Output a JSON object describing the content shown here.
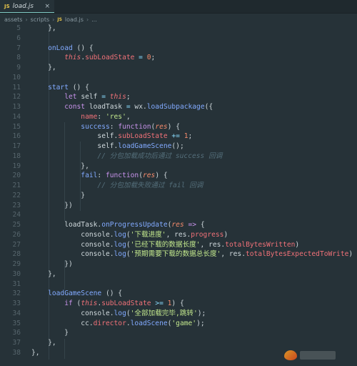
{
  "tab": {
    "badge": "JS",
    "label": "load.js",
    "close": "×"
  },
  "breadcrumb": [
    "assets",
    "scripts",
    "load.js",
    "..."
  ],
  "breadcrumb_badge": "JS",
  "colors": {
    "background": "#263238",
    "keyword": "#c792ea",
    "function": "#82aaff",
    "string": "#c3e88d",
    "number": "#f78c6c",
    "comment": "#546e7a"
  },
  "lines": [
    {
      "n": "5",
      "t": [
        {
          "c": "p",
          "v": "    },"
        }
      ]
    },
    {
      "n": "6",
      "t": []
    },
    {
      "n": "7",
      "t": [
        {
          "c": "fn",
          "v": "    onLoad"
        },
        {
          "c": "p",
          "v": " () {"
        }
      ]
    },
    {
      "n": "8",
      "t": [
        {
          "c": "th",
          "v": "        this"
        },
        {
          "c": "p",
          "v": "."
        },
        {
          "c": "var",
          "v": "subLoadState"
        },
        {
          "c": "op",
          "v": " = "
        },
        {
          "c": "num",
          "v": "0"
        },
        {
          "c": "p",
          "v": ";"
        }
      ]
    },
    {
      "n": "9",
      "t": [
        {
          "c": "p",
          "v": "    },"
        }
      ]
    },
    {
      "n": "10",
      "t": []
    },
    {
      "n": "11",
      "t": [
        {
          "c": "fn",
          "v": "    start"
        },
        {
          "c": "p",
          "v": " () {"
        }
      ]
    },
    {
      "n": "12",
      "t": [
        {
          "c": "kw",
          "v": "        let"
        },
        {
          "c": "p",
          "v": " self "
        },
        {
          "c": "op",
          "v": "="
        },
        {
          "c": "th",
          "v": " this"
        },
        {
          "c": "p",
          "v": ";"
        }
      ]
    },
    {
      "n": "13",
      "t": [
        {
          "c": "kw",
          "v": "        const"
        },
        {
          "c": "p",
          "v": " loadTask "
        },
        {
          "c": "op",
          "v": "="
        },
        {
          "c": "p",
          "v": " wx."
        },
        {
          "c": "fn",
          "v": "loadSubpackage"
        },
        {
          "c": "p",
          "v": "({"
        }
      ]
    },
    {
      "n": "14",
      "t": [
        {
          "c": "var",
          "v": "            name"
        },
        {
          "c": "p",
          "v": ": "
        },
        {
          "c": "str",
          "v": "'res'"
        },
        {
          "c": "p",
          "v": ","
        }
      ]
    },
    {
      "n": "15",
      "t": [
        {
          "c": "fn",
          "v": "            success"
        },
        {
          "c": "p",
          "v": ": "
        },
        {
          "c": "kw",
          "v": "function"
        },
        {
          "c": "p",
          "v": "("
        },
        {
          "c": "param",
          "v": "res"
        },
        {
          "c": "p",
          "v": ") {"
        }
      ]
    },
    {
      "n": "16",
      "t": [
        {
          "c": "p",
          "v": "                self."
        },
        {
          "c": "var",
          "v": "subLoadState"
        },
        {
          "c": "op",
          "v": " += "
        },
        {
          "c": "num",
          "v": "1"
        },
        {
          "c": "p",
          "v": ";"
        }
      ]
    },
    {
      "n": "17",
      "t": [
        {
          "c": "p",
          "v": "                self."
        },
        {
          "c": "fn",
          "v": "loadGameScene"
        },
        {
          "c": "p",
          "v": "();"
        }
      ]
    },
    {
      "n": "18",
      "t": [
        {
          "c": "cm",
          "v": "                // 分包加载成功后通过 success 回调"
        }
      ]
    },
    {
      "n": "19",
      "t": [
        {
          "c": "p",
          "v": "            },"
        }
      ]
    },
    {
      "n": "20",
      "t": [
        {
          "c": "fn",
          "v": "            fail"
        },
        {
          "c": "p",
          "v": ": "
        },
        {
          "c": "kw",
          "v": "function"
        },
        {
          "c": "p",
          "v": "("
        },
        {
          "c": "param",
          "v": "res"
        },
        {
          "c": "p",
          "v": ") {"
        }
      ]
    },
    {
      "n": "21",
      "t": [
        {
          "c": "cm",
          "v": "                // 分包加载失败通过 fail 回调"
        }
      ]
    },
    {
      "n": "22",
      "t": [
        {
          "c": "p",
          "v": "            }"
        }
      ]
    },
    {
      "n": "23",
      "t": [
        {
          "c": "p",
          "v": "        })"
        }
      ]
    },
    {
      "n": "24",
      "t": []
    },
    {
      "n": "25",
      "t": [
        {
          "c": "p",
          "v": "        loadTask."
        },
        {
          "c": "fn",
          "v": "onProgressUpdate"
        },
        {
          "c": "p",
          "v": "("
        },
        {
          "c": "param",
          "v": "res"
        },
        {
          "c": "kw",
          "v": " =>"
        },
        {
          "c": "p",
          "v": " {"
        }
      ]
    },
    {
      "n": "26",
      "t": [
        {
          "c": "p",
          "v": "            console."
        },
        {
          "c": "fn",
          "v": "log"
        },
        {
          "c": "p",
          "v": "("
        },
        {
          "c": "str",
          "v": "'下载进度'"
        },
        {
          "c": "p",
          "v": ", res."
        },
        {
          "c": "var",
          "v": "progress"
        },
        {
          "c": "p",
          "v": ")"
        }
      ]
    },
    {
      "n": "27",
      "t": [
        {
          "c": "p",
          "v": "            console."
        },
        {
          "c": "fn",
          "v": "log"
        },
        {
          "c": "p",
          "v": "("
        },
        {
          "c": "str",
          "v": "'已经下载的数据长度'"
        },
        {
          "c": "p",
          "v": ", res."
        },
        {
          "c": "var",
          "v": "totalBytesWritten"
        },
        {
          "c": "p",
          "v": ")"
        }
      ]
    },
    {
      "n": "28",
      "t": [
        {
          "c": "p",
          "v": "            console."
        },
        {
          "c": "fn",
          "v": "log"
        },
        {
          "c": "p",
          "v": "("
        },
        {
          "c": "str",
          "v": "'预期需要下载的数据总长度'"
        },
        {
          "c": "p",
          "v": ", res."
        },
        {
          "c": "var",
          "v": "totalBytesExpectedToWrite"
        },
        {
          "c": "p",
          "v": ")"
        }
      ]
    },
    {
      "n": "29",
      "t": [
        {
          "c": "p",
          "v": "        })"
        }
      ]
    },
    {
      "n": "30",
      "t": [
        {
          "c": "p",
          "v": "    },"
        }
      ]
    },
    {
      "n": "31",
      "t": []
    },
    {
      "n": "32",
      "t": [
        {
          "c": "fn",
          "v": "    loadGameScene"
        },
        {
          "c": "p",
          "v": " () {"
        }
      ]
    },
    {
      "n": "33",
      "t": [
        {
          "c": "kw",
          "v": "        if"
        },
        {
          "c": "p",
          "v": " ("
        },
        {
          "c": "th",
          "v": "this"
        },
        {
          "c": "p",
          "v": "."
        },
        {
          "c": "var",
          "v": "subLoadState"
        },
        {
          "c": "op",
          "v": " >= "
        },
        {
          "c": "num",
          "v": "1"
        },
        {
          "c": "p",
          "v": ") {"
        }
      ]
    },
    {
      "n": "34",
      "t": [
        {
          "c": "p",
          "v": "            console."
        },
        {
          "c": "fn",
          "v": "log"
        },
        {
          "c": "p",
          "v": "("
        },
        {
          "c": "str",
          "v": "'全部加载完毕,跳转'"
        },
        {
          "c": "p",
          "v": ");"
        }
      ]
    },
    {
      "n": "35",
      "t": [
        {
          "c": "p",
          "v": "            cc."
        },
        {
          "c": "var",
          "v": "director"
        },
        {
          "c": "p",
          "v": "."
        },
        {
          "c": "fn",
          "v": "loadScene"
        },
        {
          "c": "p",
          "v": "("
        },
        {
          "c": "str",
          "v": "'game'"
        },
        {
          "c": "p",
          "v": ");"
        }
      ]
    },
    {
      "n": "36",
      "t": [
        {
          "c": "p",
          "v": "        }"
        }
      ]
    },
    {
      "n": "37",
      "t": [
        {
          "c": "p",
          "v": "    },"
        }
      ]
    },
    {
      "n": "38",
      "t": [
        {
          "c": "p",
          "v": "},"
        }
      ]
    }
  ]
}
